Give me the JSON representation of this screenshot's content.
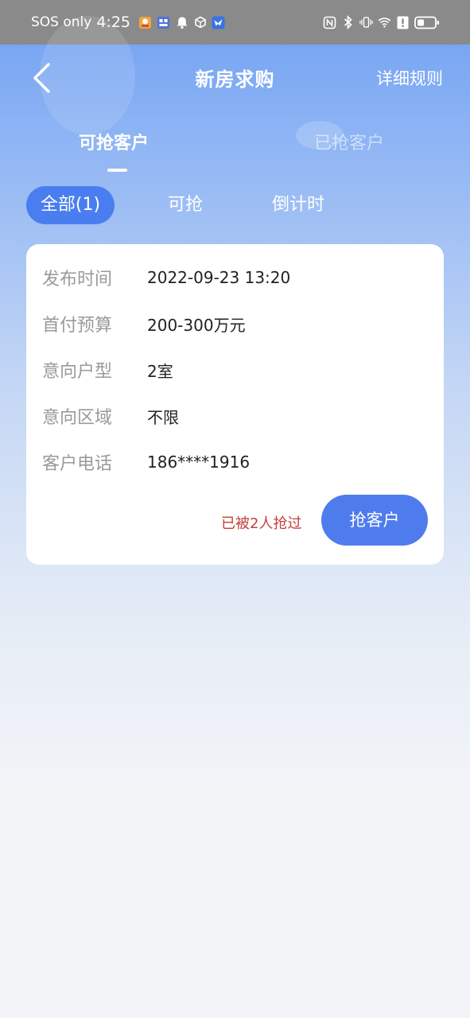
{
  "status_bar": {
    "carrier": "SOS only",
    "time": "4:25"
  },
  "header": {
    "title": "新房求购",
    "rules_label": "详细规则"
  },
  "tabs": [
    {
      "label": "可抢客户",
      "active": true
    },
    {
      "label": "已抢客户",
      "active": false
    }
  ],
  "filters": [
    {
      "label": "全部(1)",
      "active": true
    },
    {
      "label": "可抢",
      "active": false
    },
    {
      "label": "倒计时",
      "active": false
    }
  ],
  "card": {
    "rows": [
      {
        "label": "发布时间",
        "value": "2022-09-23 13:20"
      },
      {
        "label": "首付预算",
        "value": "200-300万元"
      },
      {
        "label": "意向户型",
        "value": "2室"
      },
      {
        "label": "意向区域",
        "value": "不限"
      },
      {
        "label": "客户电话",
        "value": "186****1916"
      }
    ],
    "grabbed_text": "已被2人抢过",
    "grab_button": "抢客户"
  },
  "colors": {
    "accent": "#4f7ced",
    "pill_active": "#4a7ef0",
    "warning_text": "#c2413b"
  }
}
